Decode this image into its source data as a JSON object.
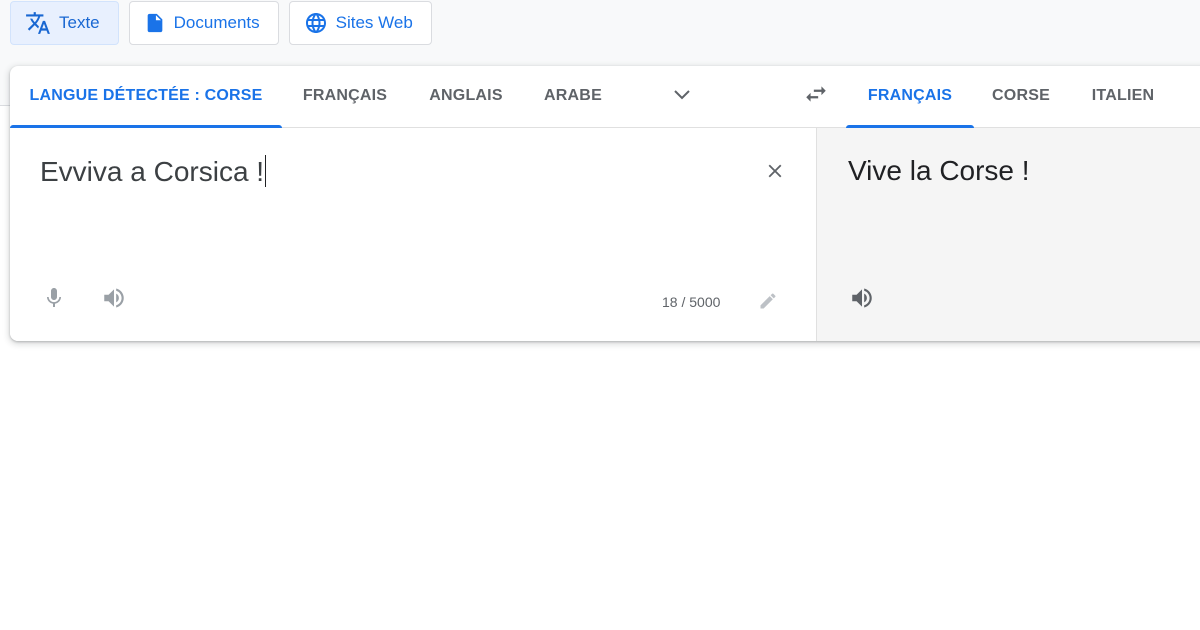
{
  "mode_bar": {
    "text_label": "Texte",
    "documents_label": "Documents",
    "websites_label": "Sites Web"
  },
  "source_languages": {
    "tabs": [
      "LANGUE DÉTECTÉE : CORSE",
      "FRANÇAIS",
      "ANGLAIS",
      "ARABE"
    ],
    "active_index": 0
  },
  "target_languages": {
    "tabs": [
      "FRANÇAIS",
      "CORSE",
      "ITALIEN"
    ],
    "active_index": 0
  },
  "source": {
    "text": "Evviva a Corsica !",
    "char_count": "18 / 5000"
  },
  "target": {
    "text": "Vive la Corse !"
  },
  "colors": {
    "accent": "#1a73e8",
    "active_mode_bg": "#e8f0fe",
    "target_pane_bg": "#f5f5f5",
    "icon_gray": "#5f6368"
  },
  "icons": {
    "text_mode": "translate-icon",
    "documents_mode": "document-icon",
    "websites_mode": "globe-icon",
    "more_languages": "chevron-down-icon",
    "swap": "swap-languages-icon",
    "clear": "close-icon",
    "microphone": "microphone-icon",
    "listen": "speaker-icon",
    "edit": "pencil-icon"
  }
}
